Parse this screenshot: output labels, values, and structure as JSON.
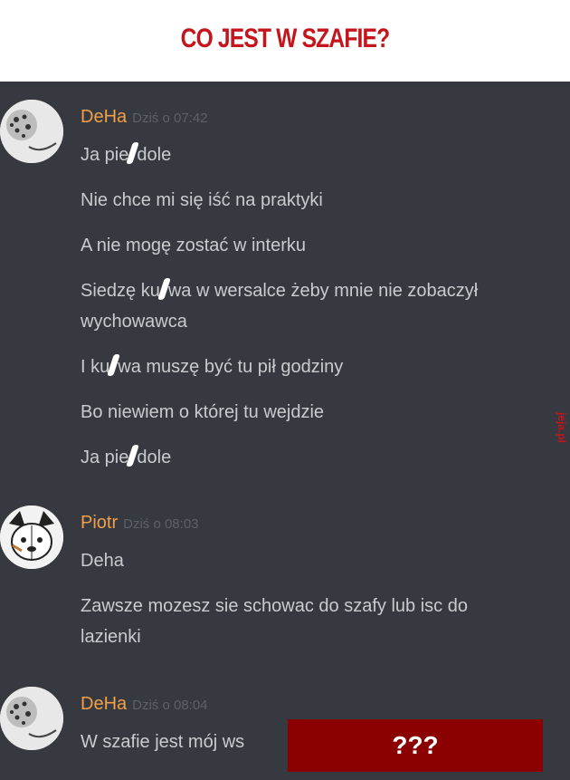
{
  "header": {
    "title": "CO JEST W SZAFIE?"
  },
  "watermark": "jeja.pl",
  "messages": [
    {
      "author": "DeHa",
      "time": "Dziś o 07:42",
      "lines": [
        "Ja pie|dole",
        "Nie chce mi się iść na praktyki",
        "A nie mogę zostać w interku",
        "Siedzę ku|wa w wersalce żeby mnie nie zobaczył",
        "wychowawca",
        "I ku|wa muszę być tu pił godziny",
        "Bo niewiem o której tu wejdzie",
        "Ja pie|dole"
      ]
    },
    {
      "author": "Piotr",
      "time": "Dziś o 08:03",
      "lines": [
        "Deha",
        "Zawsze mozesz sie schowac do szafy lub isc do",
        "lazienki"
      ]
    },
    {
      "author": "DeHa",
      "time": "Dziś o 08:04",
      "lines": [
        "W szafie jest mój ws"
      ]
    }
  ],
  "overlay": {
    "text": "???"
  },
  "colors": {
    "title": "#c4141c",
    "background": "#36393f",
    "author": "#f1a04a",
    "text": "#c9cbce",
    "overlay": "#8b0000"
  }
}
